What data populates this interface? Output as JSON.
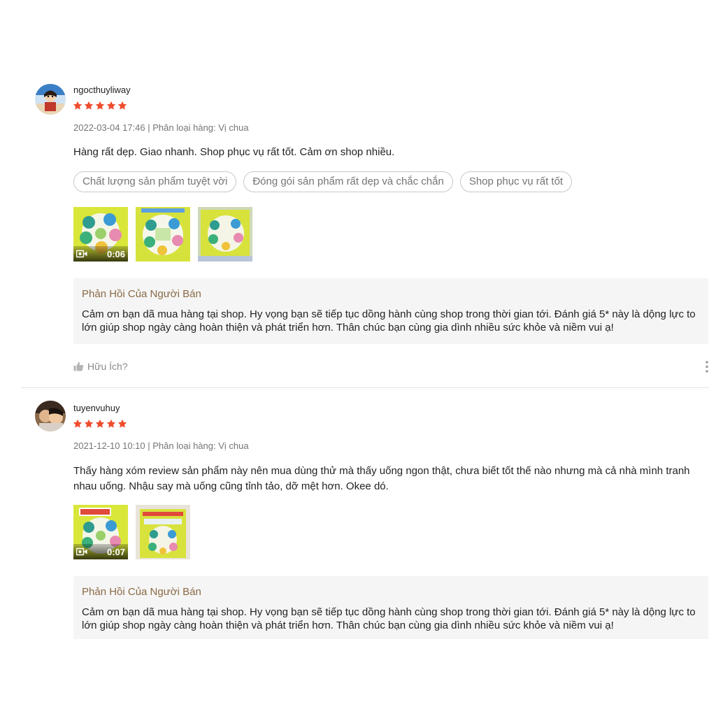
{
  "colors": {
    "star": "#ee4d2d",
    "reply_title": "#8a6a45",
    "meta": "#757575"
  },
  "reviews": [
    {
      "username": "ngocthuyliway",
      "rating": 5,
      "meta": "2022-03-04 17:46 | Phân loại hàng: Vị chua",
      "comment": "Hàng rất dẹp. Giao nhanh. Shop phục vụ rất tốt. Cảm ơn shop nhiều.",
      "tags": [
        "Chất lượng sản phẩm tuyệt vời",
        "Đóng gói sản phẩm rất dẹp và chắc chắn",
        "Shop phục vụ rất tốt"
      ],
      "video_duration": "0:06",
      "reply_title": "Phản Hồi Của Người Bán",
      "reply_text": "Cảm ơn bạn dã mua hàng tại shop. Hy vọng bạn sẽ tiếp tục dồng hành cùng shop trong thời gian tới. Đánh giá 5* này là dộng lực to lớn giúp shop ngày càng hoàn thiện và phát triển hơn. Thân chúc bạn cùng gia dình nhiều sức khỏe và niềm vui ạ!",
      "helpful_label": "Hữu Ích?"
    },
    {
      "username": "tuyenvuhuy",
      "rating": 5,
      "meta": "2021-12-10 10:10 | Phân loại hàng: Vị chua",
      "comment": "Thấy hàng xóm review sản phẩm này nên mua dùng thử mà thấy uống ngon thật, chưa biết tốt thế nào nhưng mà cả nhà mình tranh nhau uống.  Nhậu say mà uống cũng tỉnh tảo, dỡ mệt hơn. Okee dó.",
      "video_duration": "0:07",
      "reply_title": "Phản Hồi Của Người Bán",
      "reply_text": "Cảm ơn bạn dã mua hàng tại shop. Hy vọng bạn sẽ tiếp tục dồng hành cùng shop trong thời gian tới. Đánh giá 5* này là dộng lực to lớn giúp shop ngày càng hoàn thiện và phát triển hơn. Thân chúc bạn cùng gia dình nhiều sức khỏe và niềm vui ạ!"
    }
  ]
}
